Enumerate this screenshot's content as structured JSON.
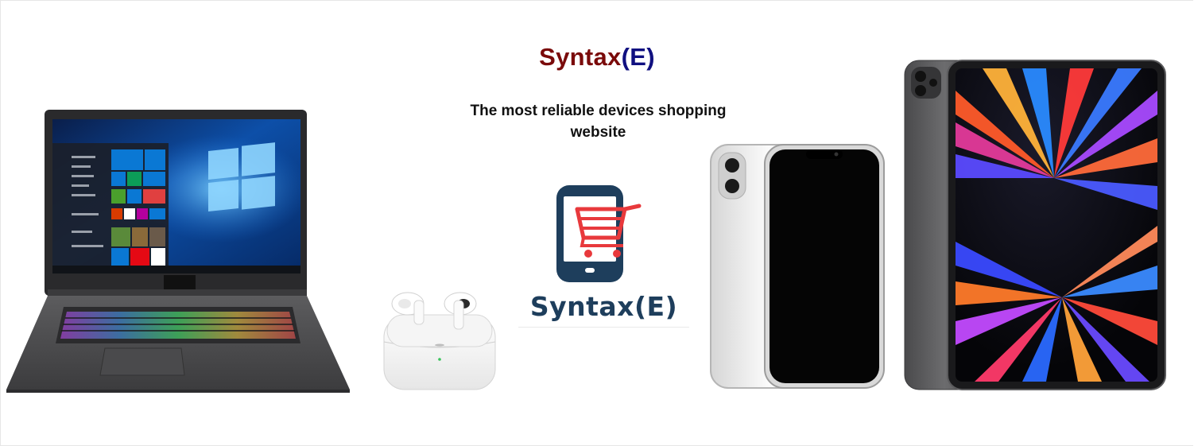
{
  "hero": {
    "brand_name": "Syntax",
    "brand_suffix": "(E)",
    "tagline": "The most reliable devices shopping website",
    "logo_text": "Syntax(E)"
  },
  "devices": [
    {
      "name": "laptop"
    },
    {
      "name": "wireless-earbuds"
    },
    {
      "name": "smartphone"
    },
    {
      "name": "tablet"
    }
  ],
  "colors": {
    "brand_name": "#7a0a0a",
    "brand_suffix": "#101080",
    "logo_dark": "#1e3e5c",
    "logo_cart": "#e8393c"
  }
}
